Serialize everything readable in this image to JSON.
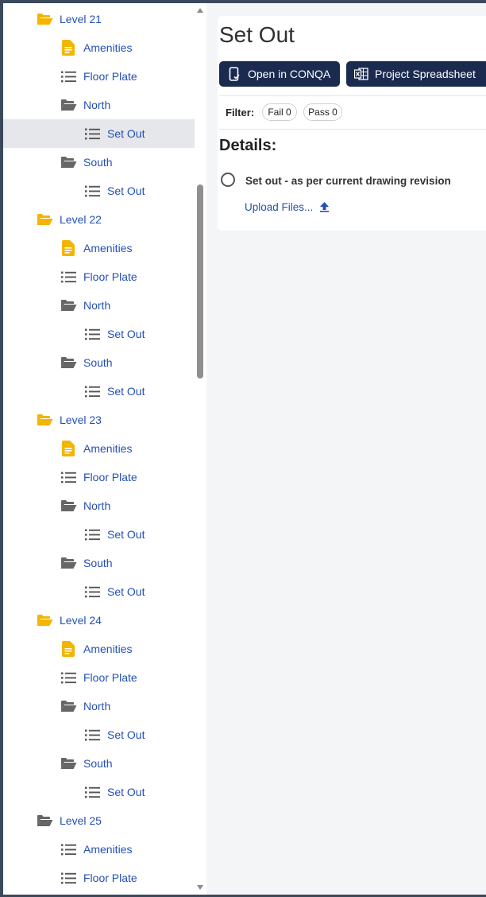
{
  "sidebar": {
    "items": [
      {
        "label": "Level 21",
        "icon": "folder-open-icon",
        "depth": 0
      },
      {
        "label": "Amenities",
        "icon": "document-icon",
        "depth": 1
      },
      {
        "label": "Floor Plate",
        "icon": "checklist-icon",
        "depth": 1
      },
      {
        "label": "North",
        "icon": "folder-open-icon",
        "depth": 1
      },
      {
        "label": "Set Out",
        "icon": "checklist-icon",
        "depth": 2,
        "selected": true
      },
      {
        "label": "South",
        "icon": "folder-open-icon",
        "depth": 1
      },
      {
        "label": "Set Out",
        "icon": "checklist-icon",
        "depth": 2
      },
      {
        "label": "Level 22",
        "icon": "folder-open-icon",
        "depth": 0
      },
      {
        "label": "Amenities",
        "icon": "document-icon",
        "depth": 1
      },
      {
        "label": "Floor Plate",
        "icon": "checklist-icon",
        "depth": 1
      },
      {
        "label": "North",
        "icon": "folder-open-icon",
        "depth": 1
      },
      {
        "label": "Set Out",
        "icon": "checklist-icon",
        "depth": 2
      },
      {
        "label": "South",
        "icon": "folder-open-icon",
        "depth": 1
      },
      {
        "label": "Set Out",
        "icon": "checklist-icon",
        "depth": 2
      },
      {
        "label": "Level 23",
        "icon": "folder-open-icon",
        "depth": 0
      },
      {
        "label": "Amenities",
        "icon": "document-icon",
        "depth": 1
      },
      {
        "label": "Floor Plate",
        "icon": "checklist-icon",
        "depth": 1
      },
      {
        "label": "North",
        "icon": "folder-open-icon",
        "depth": 1
      },
      {
        "label": "Set Out",
        "icon": "checklist-icon",
        "depth": 2
      },
      {
        "label": "South",
        "icon": "folder-open-icon",
        "depth": 1
      },
      {
        "label": "Set Out",
        "icon": "checklist-icon",
        "depth": 2
      },
      {
        "label": "Level 24",
        "icon": "folder-open-icon",
        "depth": 0
      },
      {
        "label": "Amenities",
        "icon": "document-icon",
        "depth": 1
      },
      {
        "label": "Floor Plate",
        "icon": "checklist-icon",
        "depth": 1
      },
      {
        "label": "North",
        "icon": "folder-open-icon",
        "depth": 1
      },
      {
        "label": "Set Out",
        "icon": "checklist-icon",
        "depth": 2
      },
      {
        "label": "South",
        "icon": "folder-open-icon",
        "depth": 1
      },
      {
        "label": "Set Out",
        "icon": "checklist-icon",
        "depth": 2
      },
      {
        "label": "Level 25",
        "icon": "folder-open-icon",
        "depth": 0,
        "icon_color": "grey"
      },
      {
        "label": "Amenities",
        "icon": "checklist-icon",
        "depth": 1
      },
      {
        "label": "Floor Plate",
        "icon": "checklist-icon",
        "depth": 1
      }
    ]
  },
  "main": {
    "title": "Set Out",
    "buttons": {
      "open_conqa": "Open in CONQA",
      "project_spreadsheet": "Project Spreadsheet"
    },
    "filter": {
      "label": "Filter:",
      "fail": "Fail 0",
      "pass": "Pass 0"
    },
    "details_heading": "Details:",
    "checklist_item": "Set out - as per current drawing revision",
    "upload_link": "Upload Files..."
  },
  "colors": {
    "accent": "#1b2b50",
    "link": "#2450b4",
    "folder_yellow": "#f4b400",
    "folder_grey": "#666666",
    "selected_row": "#e6e7ea"
  }
}
